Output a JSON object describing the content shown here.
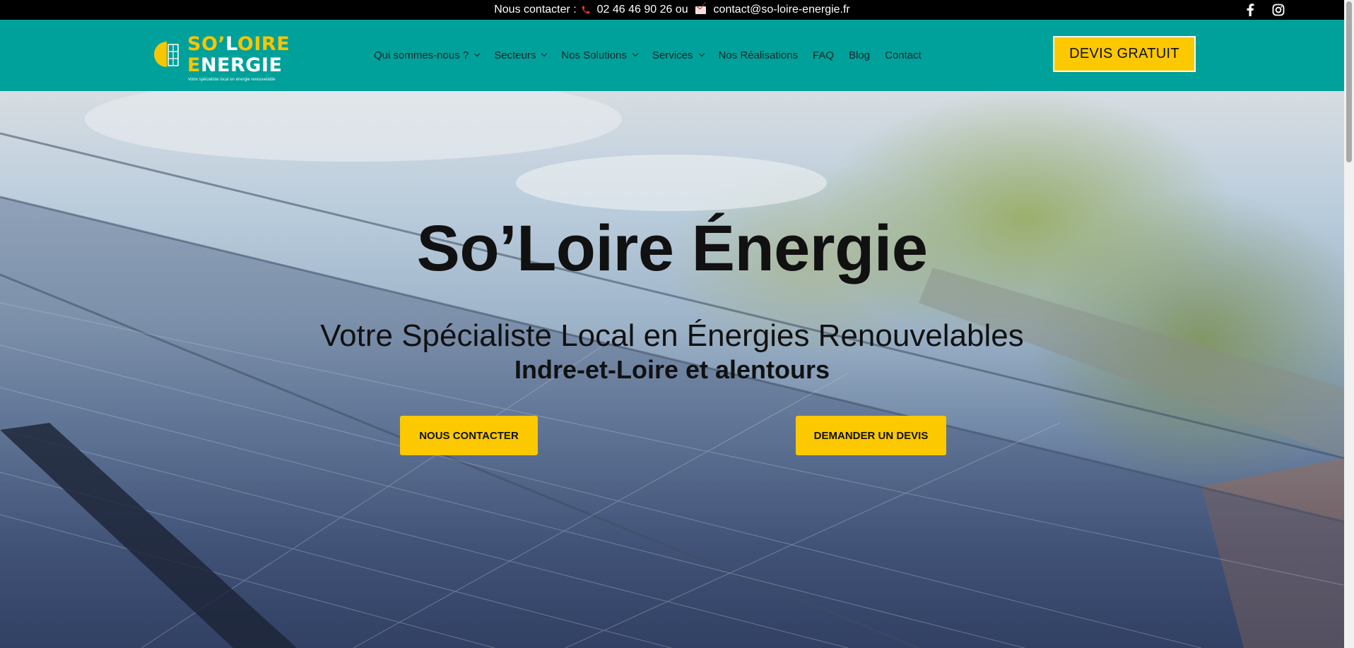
{
  "topbar": {
    "label": "Nous contacter :",
    "phone": "02 46 46 90 26",
    "or_text": "ou",
    "email": "contact@so-loire-energie.fr",
    "phone_icon": "phone-icon",
    "email_icon": "mail-icon",
    "social": [
      {
        "name": "facebook",
        "icon": "facebook-icon"
      },
      {
        "name": "instagram",
        "icon": "instagram-icon"
      }
    ]
  },
  "logo": {
    "line1_a": "SO’",
    "line1_b": "L",
    "line1_c": "OIRE",
    "line2_a": "E",
    "line2_b": "NERGIE",
    "tagline": "Votre spécialiste local en énergie renouvelable"
  },
  "nav": {
    "items": [
      {
        "label": "Qui sommes-nous ?",
        "dropdown": true
      },
      {
        "label": "Secteurs",
        "dropdown": true
      },
      {
        "label": "Nos Solutions",
        "dropdown": true
      },
      {
        "label": "Services",
        "dropdown": true
      },
      {
        "label": "Nos Réalisations",
        "dropdown": false
      },
      {
        "label": "FAQ",
        "dropdown": false
      },
      {
        "label": "Blog",
        "dropdown": false
      },
      {
        "label": "Contact",
        "dropdown": false
      }
    ],
    "cta_label": "DEVIS GRATUIT"
  },
  "hero": {
    "title": "So’Loire Énergie",
    "subtitle": "Votre Spécialiste Local en Énergies Renouvelables",
    "subtitle2": "Indre-et-Loire et alentours",
    "button_contact": "NOUS CONTACTER",
    "button_devis": "DEMANDER UN DEVIS"
  },
  "colors": {
    "topbar_bg": "#000000",
    "header_bg": "#00a19a",
    "accent_yellow": "#fcc800",
    "text_dark": "#111111"
  }
}
